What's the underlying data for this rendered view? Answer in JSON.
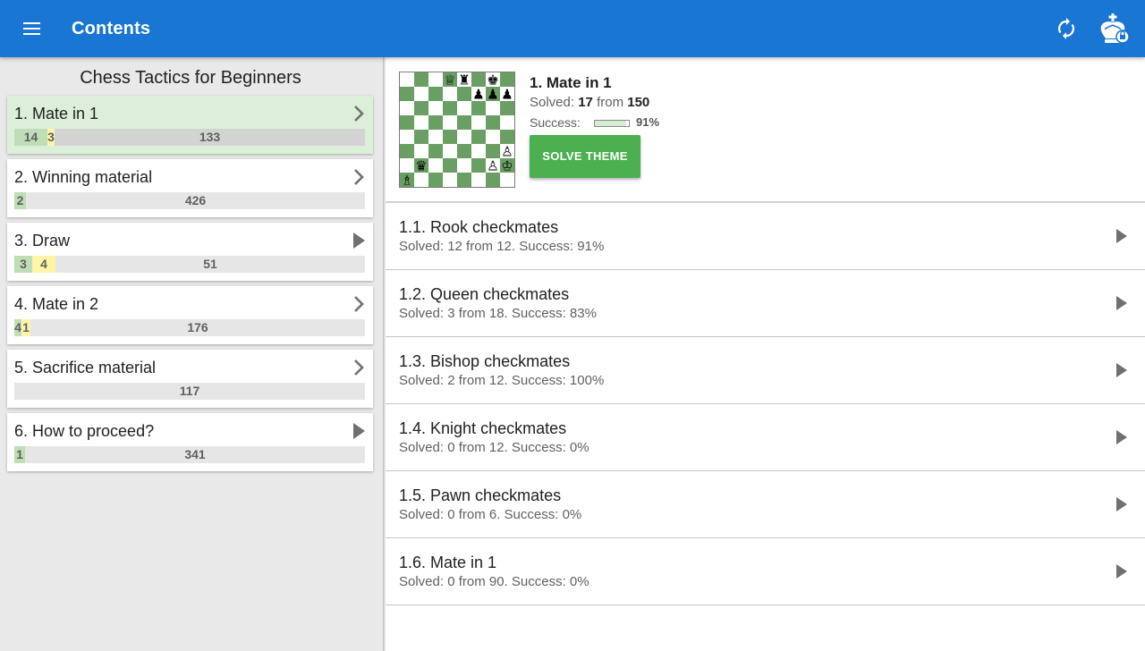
{
  "appbar": {
    "title": "Contents",
    "menu_icon": "menu-icon",
    "sync_icon": "sync-icon",
    "king_icon": "king-icon",
    "color": "#1976d2"
  },
  "sidebar": {
    "title": "Chess Tactics for Beginners",
    "items": [
      {
        "label": "1. Mate in 1",
        "arrow": "chevron-right-icon",
        "selected": true,
        "segments": [
          {
            "type": "green",
            "text": "14",
            "frac": 0.094
          },
          {
            "type": "yellow",
            "text": "3",
            "frac": 0.02
          },
          {
            "type": "gray",
            "text": "133",
            "frac": 0.886
          }
        ]
      },
      {
        "label": "2. Winning material",
        "arrow": "chevron-right-icon",
        "selected": false,
        "segments": [
          {
            "type": "green",
            "text": "2",
            "frac": 0.033
          },
          {
            "type": "rest",
            "text": "426",
            "frac": 0.967
          }
        ]
      },
      {
        "label": "3. Draw",
        "arrow": "play-icon",
        "selected": false,
        "segments": [
          {
            "type": "green",
            "text": "3",
            "frac": 0.05
          },
          {
            "type": "yellow",
            "text": "4",
            "frac": 0.066
          },
          {
            "type": "rest",
            "text": "51",
            "frac": 0.884
          }
        ]
      },
      {
        "label": "4. Mate in 2",
        "arrow": "chevron-right-icon",
        "selected": false,
        "segments": [
          {
            "type": "green",
            "text": "4",
            "frac": 0.02
          },
          {
            "type": "yellow",
            "text": "1",
            "frac": 0.025
          },
          {
            "type": "rest",
            "text": "176",
            "frac": 0.955
          }
        ]
      },
      {
        "label": "5. Sacrifice material",
        "arrow": "chevron-right-icon",
        "selected": false,
        "segments": [
          {
            "type": "rest",
            "text": "117",
            "frac": 1.0
          }
        ]
      },
      {
        "label": "6. How to proceed?",
        "arrow": "play-icon",
        "selected": false,
        "segments": [
          {
            "type": "green",
            "text": "1",
            "frac": 0.031
          },
          {
            "type": "rest",
            "text": "341",
            "frac": 0.969
          }
        ]
      }
    ]
  },
  "theme": {
    "title": "1. Mate in 1",
    "solved_prefix": "Solved:",
    "solved_count": "17",
    "from_word": "from",
    "total": "150",
    "success_label": "Success:",
    "success_pct": "91%",
    "success_frac": 0.91,
    "solve_button": "SOLVE THEME",
    "board": {
      "light": "#ffffff",
      "dark": "#6a9f63",
      "pieces": [
        {
          "sq": "d8",
          "glyph": "♕"
        },
        {
          "sq": "e8",
          "glyph": "♜"
        },
        {
          "sq": "g8",
          "glyph": "♚"
        },
        {
          "sq": "f7",
          "glyph": "♟"
        },
        {
          "sq": "g7",
          "glyph": "♟"
        },
        {
          "sq": "h7",
          "glyph": "♟"
        },
        {
          "sq": "h3",
          "glyph": "♙"
        },
        {
          "sq": "b2",
          "glyph": "♛"
        },
        {
          "sq": "g2",
          "glyph": "♙"
        },
        {
          "sq": "h2",
          "glyph": "♔"
        },
        {
          "sq": "a1",
          "glyph": "♗"
        }
      ]
    }
  },
  "subthemes": [
    {
      "title": "1.1. Rook checkmates",
      "info": "Solved: 12 from 12. Success: 91%"
    },
    {
      "title": "1.2. Queen checkmates",
      "info": "Solved: 3 from 18. Success: 83%"
    },
    {
      "title": "1.3. Bishop checkmates",
      "info": "Solved: 2 from 12. Success: 100%"
    },
    {
      "title": "1.4. Knight checkmates",
      "info": "Solved: 0 from 12. Success: 0%"
    },
    {
      "title": "1.5. Pawn checkmates",
      "info": "Solved: 0 from 6. Success: 0%"
    },
    {
      "title": "1.6. Mate in 1",
      "info": "Solved: 0 from 90. Success: 0%"
    }
  ]
}
